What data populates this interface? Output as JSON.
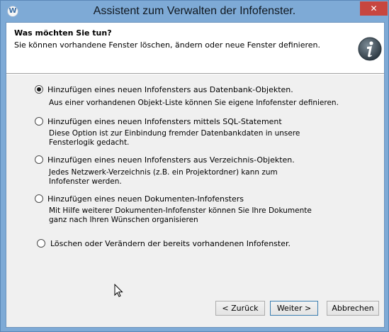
{
  "window": {
    "title": "Assistent zum Verwalten der Infofenster.",
    "app_icon_glyph": "W",
    "close_glyph": "✕"
  },
  "header": {
    "title": "Was möchten Sie tun?",
    "subtitle": "Sie können vorhandene Fenster löschen, ändern oder neue Fenster definieren.",
    "icon": "info-icon"
  },
  "options": [
    {
      "label": "Hinzufügen eines neuen Infofensters aus Datenbank-Objekten.",
      "description": "Aus einer vorhandenen Objekt-Liste können Sie eigene Infofenster definieren.",
      "selected": true
    },
    {
      "label": "Hinzufügen eines neuen Infofensters mittels SQL-Statement",
      "description": "Diese Option ist zur Einbindung fremder Datenbankdaten in unsere Fensterlogik gedacht.",
      "selected": false
    },
    {
      "label": "Hinzufügen eines neuen Infofensters aus Verzeichnis-Objekten.",
      "description": "Jedes Netzwerk-Verzeichnis (z.B. ein Projektordner) kann zum Infofenster werden.",
      "selected": false
    },
    {
      "label": "Hinzufügen eines neuen Dokumenten-Infofensters",
      "description": "Mit Hilfe weiterer Dokumenten-Infofenster können Sie Ihre Dokumente ganz nach Ihren Wünschen organisieren",
      "selected": false
    },
    {
      "label": "Löschen oder Verändern der bereits vorhandenen Infofenster.",
      "description": "",
      "selected": false
    }
  ],
  "buttons": {
    "back": "< Zurück",
    "next": "Weiter >",
    "cancel": "Abbrechen"
  },
  "colors": {
    "frame": "#7eaad6",
    "close": "#c7463f",
    "info_icon": "#4a5a66"
  }
}
